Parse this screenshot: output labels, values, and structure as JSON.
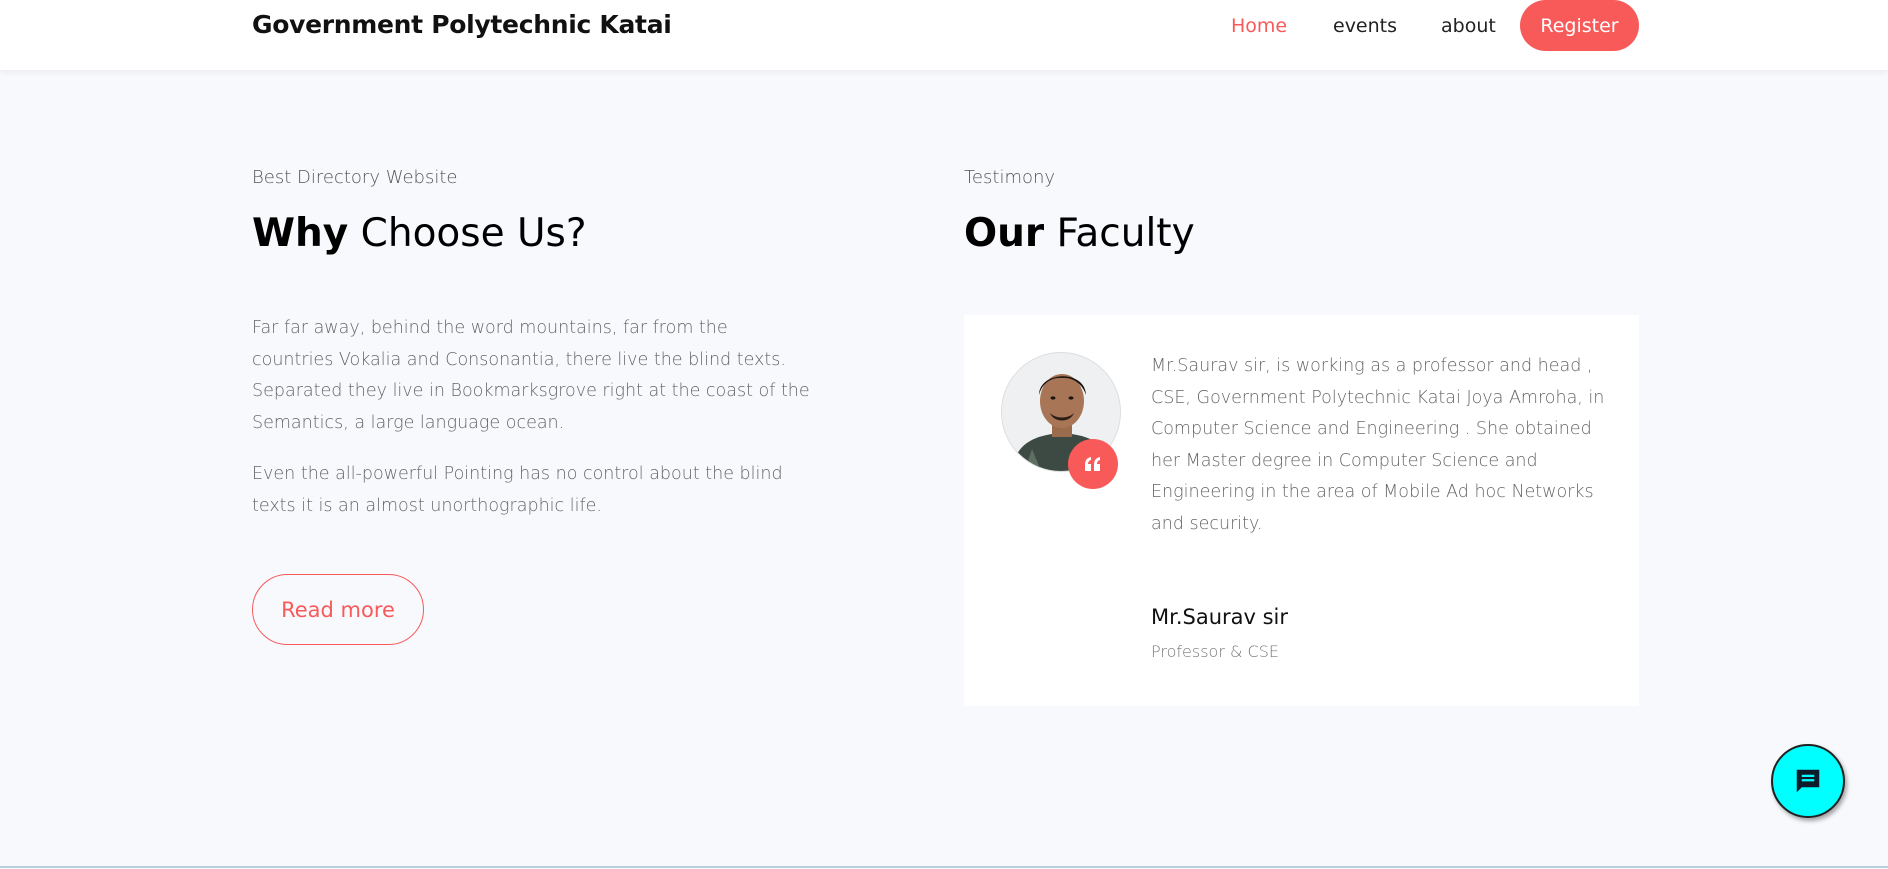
{
  "navbar": {
    "brand": "Government Polytechnic Katai",
    "links": [
      {
        "label": "Home",
        "active": true
      },
      {
        "label": "events",
        "active": false
      },
      {
        "label": "about",
        "active": false
      }
    ],
    "register_label": "Register"
  },
  "why": {
    "subheading": "Best Directory Website",
    "heading_bold": "Why",
    "heading_rest": " Choose Us?",
    "paragraph1": "Far far away, behind the word mountains, far from the countries Vokalia and Consonantia, there live the blind texts. Separated they live in Bookmarksgrove right at the coast of the Semantics, a large language ocean.",
    "paragraph2": "Even the all-powerful Pointing has no control about the blind texts it is an almost unorthographic life.",
    "read_more_label": "Read more"
  },
  "testimony": {
    "subheading": "Testimony",
    "heading_bold": "Our",
    "heading_rest": " Faculty",
    "text": "Mr.Saurav sir, is working as a professor and head , CSE, Government Polytechnic Katai Joya Amroha, in Computer Science and Engineering . She obtained her Master degree in Computer Science and Engineering in the area of Mobile Ad hoc Networks and security.",
    "name": "Mr.Saurav sir",
    "role": "Professor & CSE",
    "avatar_icon": "person-photo",
    "quote_icon": "quote-icon"
  },
  "chat": {
    "icon": "chat-icon"
  },
  "colors": {
    "accent": "#f85a5a",
    "background": "#f8f9fd",
    "chat": "#00ffff"
  }
}
